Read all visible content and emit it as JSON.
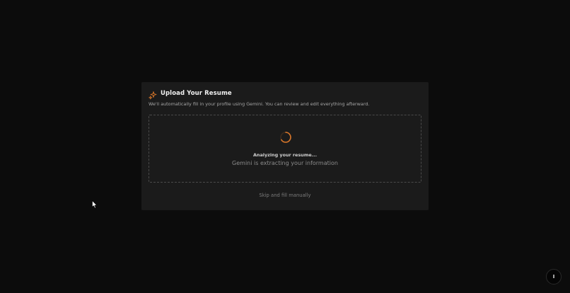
{
  "card": {
    "title": "Upload Your Resume",
    "description": "We'll automatically fill in your profile using Gemini. You can review and edit everything afterward.",
    "icon": "sparkle-icon",
    "accent_color": "#d9772a"
  },
  "dropzone": {
    "status_title": "Analyzing your resume...",
    "status_subtitle": "Gemini is extracting your information",
    "spinner_icon": "loading-spinner-icon"
  },
  "actions": {
    "skip_label": "Skip and fill manually"
  },
  "floating_button": {
    "label": "I"
  }
}
